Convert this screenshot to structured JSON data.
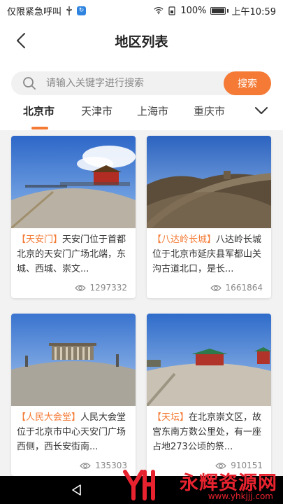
{
  "status_bar": {
    "carrier_text": "仅限紧急呼叫",
    "battery_percent": "100%",
    "time": "上午10:59"
  },
  "header": {
    "title": "地区列表"
  },
  "search": {
    "placeholder": "请输入关键字进行搜索",
    "button_label": "搜索"
  },
  "tabs": [
    {
      "label": "北京市",
      "active": true
    },
    {
      "label": "天津市",
      "active": false
    },
    {
      "label": "上海市",
      "active": false
    },
    {
      "label": "重庆市",
      "active": false
    }
  ],
  "cards": [
    {
      "tag": "【天安门】",
      "desc": "天安门位于首都北京的天安门广场北端，东城、西城、崇文...",
      "views": "1297332"
    },
    {
      "tag": "【八达岭长城】",
      "desc": "八达岭长城位于北京市延庆县军都山关沟古道北口，是长...",
      "views": "1661864"
    },
    {
      "tag": "【人民大会堂】",
      "desc": "人民大会堂位于北京市中心天安门广场西侧，西长安街南...",
      "views": "135303"
    },
    {
      "tag": "【天坛】",
      "desc": "在北京崇文区，故宫东南方数公里处，有一座占地273公顷的祭...",
      "views": "910151"
    }
  ],
  "watermark": {
    "text": "永辉资源网",
    "url": "www.yhkjjj.com"
  },
  "colors": {
    "accent": "#f47a35",
    "watermark": "#e8232f"
  },
  "icons": {
    "back": "chevron-left-icon",
    "search": "search-icon",
    "more": "chevron-down-icon",
    "views": "eye-icon"
  }
}
